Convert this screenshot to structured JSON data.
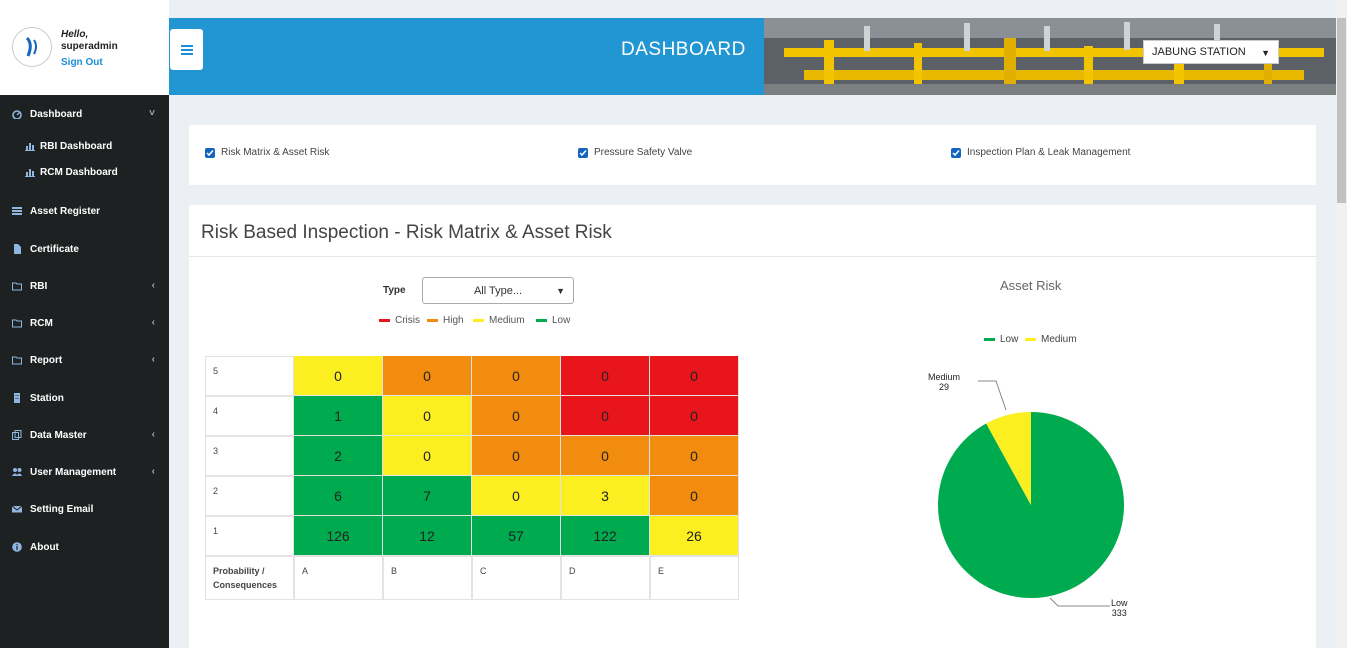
{
  "user": {
    "greeting": "Hello,",
    "name": "superadmin",
    "signout": "Sign Out"
  },
  "sidebar": {
    "items": [
      {
        "label": "Dashboard",
        "icon": "dashboard-icon",
        "chevron": "˅"
      },
      {
        "label": "RBI Dashboard",
        "icon": "bar-chart-icon"
      },
      {
        "label": "RCM Dashboard",
        "icon": "bar-chart-icon"
      },
      {
        "label": "Asset Register",
        "icon": "list-icon"
      },
      {
        "label": "Certificate",
        "icon": "file-icon"
      },
      {
        "label": "RBI",
        "icon": "folder-icon",
        "chevron": "‹"
      },
      {
        "label": "RCM",
        "icon": "folder-icon",
        "chevron": "‹"
      },
      {
        "label": "Report",
        "icon": "folder-icon",
        "chevron": "‹"
      },
      {
        "label": "Station",
        "icon": "building-icon"
      },
      {
        "label": "Data Master",
        "icon": "copy-icon",
        "chevron": "‹"
      },
      {
        "label": "User Management",
        "icon": "users-icon",
        "chevron": "‹"
      },
      {
        "label": "Setting Email",
        "icon": "envelope-icon"
      },
      {
        "label": "About",
        "icon": "info-icon"
      }
    ]
  },
  "header": {
    "title": "DASHBOARD",
    "station": "JABUNG STATION"
  },
  "filters": {
    "checkboxes": [
      "Risk Matrix & Asset Risk",
      "Pressure Safety Valve",
      "Inspection Plan & Leak Management"
    ]
  },
  "card": {
    "title": "Risk Based Inspection - Risk Matrix & Asset Risk"
  },
  "matrix": {
    "type_label": "Type",
    "type_value": "All Type...",
    "legend": [
      {
        "label": "Crisis",
        "color": "#e8161b"
      },
      {
        "label": "High",
        "color": "#f28c0f"
      },
      {
        "label": "Medium",
        "color": "#fbee21"
      },
      {
        "label": "Low",
        "color": "#00ab4f"
      }
    ],
    "row_labels": [
      "5",
      "4",
      "3",
      "2",
      "1"
    ],
    "col_labels": [
      "A",
      "B",
      "C",
      "D",
      "E"
    ],
    "corner_label": "Probability / Consequences",
    "rows": [
      {
        "values": [
          "0",
          "0",
          "0",
          "0",
          "0"
        ],
        "levels": [
          "medium",
          "high",
          "high",
          "crisis",
          "crisis"
        ]
      },
      {
        "values": [
          "1",
          "0",
          "0",
          "0",
          "0"
        ],
        "levels": [
          "low",
          "medium",
          "high",
          "crisis",
          "crisis"
        ]
      },
      {
        "values": [
          "2",
          "0",
          "0",
          "0",
          "0"
        ],
        "levels": [
          "low",
          "medium",
          "high",
          "high",
          "high"
        ]
      },
      {
        "values": [
          "6",
          "7",
          "0",
          "3",
          "0"
        ],
        "levels": [
          "low",
          "low",
          "medium",
          "medium",
          "high"
        ]
      },
      {
        "values": [
          "126",
          "12",
          "57",
          "122",
          "26"
        ],
        "levels": [
          "low",
          "low",
          "low",
          "low",
          "medium"
        ]
      }
    ],
    "colors": {
      "crisis": "#e8161b",
      "high": "#f28c0f",
      "medium": "#fbee21",
      "low": "#00ab4f"
    }
  },
  "chart_data": {
    "type": "pie",
    "title": "Asset Risk",
    "legend_position": "top",
    "categories": [
      "Low",
      "Medium"
    ],
    "values": [
      333,
      29
    ],
    "colors": [
      "#00ab4f",
      "#fbee21"
    ]
  }
}
